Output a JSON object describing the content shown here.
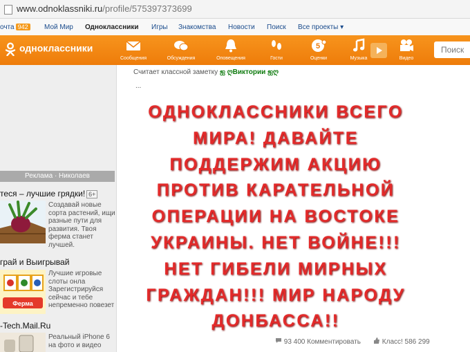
{
  "browser": {
    "url_host": "www.odnoklassniki.ru",
    "url_path": "/profile/575397373699"
  },
  "mailbar": {
    "mail_label": "очта",
    "mail_count": "942",
    "items": [
      "Мой Мир",
      "Одноклассники",
      "Игры",
      "Знакомства",
      "Новости",
      "Поиск",
      "Все проекты ▾"
    ]
  },
  "okbar": {
    "logo": "одноклассники",
    "nav": [
      {
        "label": "Сообщения",
        "icon": "envelope-icon"
      },
      {
        "label": "Обсуждения",
        "icon": "chat-icon"
      },
      {
        "label": "Оповещения",
        "icon": "bell-icon"
      },
      {
        "label": "Гости",
        "icon": "footprints-icon"
      },
      {
        "label": "Оценки",
        "icon": "rating-icon"
      },
      {
        "label": "Музыка",
        "icon": "music-icon"
      },
      {
        "label": "Видео",
        "icon": "video-icon"
      }
    ],
    "search_placeholder": "Поиск"
  },
  "sidebar": {
    "ad_header": "Реклама · Николаев",
    "ads": [
      {
        "title": "теся – лучшие грядки!",
        "badge": "6+",
        "text": "Создавай новые сорта растений, ищи разные пути для развития. Твоя ферма станет лучшей."
      },
      {
        "title": "грай и Выигрывай",
        "badge": "",
        "text": "Лучшие игровые слоты онла Зарегистрируйся сейчас и тебе непременно повезет"
      },
      {
        "title": "-Tech.Mail.Ru",
        "badge": "",
        "text": "Реальный iPhone 6 на фото и видео"
      }
    ]
  },
  "post": {
    "byline_prefix": "Считает классной заметку",
    "byline_user": "ஐ ღВиктории ஐღ",
    "dots": "...",
    "headline": "ОДНОКЛАССНИКИ ВСЕГО МИРА! ДАВАЙТЕ ПОДДЕРЖИМ АКЦИЮ ПРОТИВ КАРАТЕЛЬНОЙ ОПЕРАЦИИ НА ВОСТОКЕ УКРАИНЫ. НЕТ ВОЙНЕ!!! НЕТ ГИБЕЛИ МИРНЫХ ГРАЖДАН!!! МИР НАРОДУ ДОНБАССА!!",
    "comments": "93 400 Комментировать",
    "likes": "Класс! 586 299"
  },
  "colors": {
    "accent": "#f7941d",
    "headline": "#e32a2a",
    "link": "#1a4b8c"
  }
}
